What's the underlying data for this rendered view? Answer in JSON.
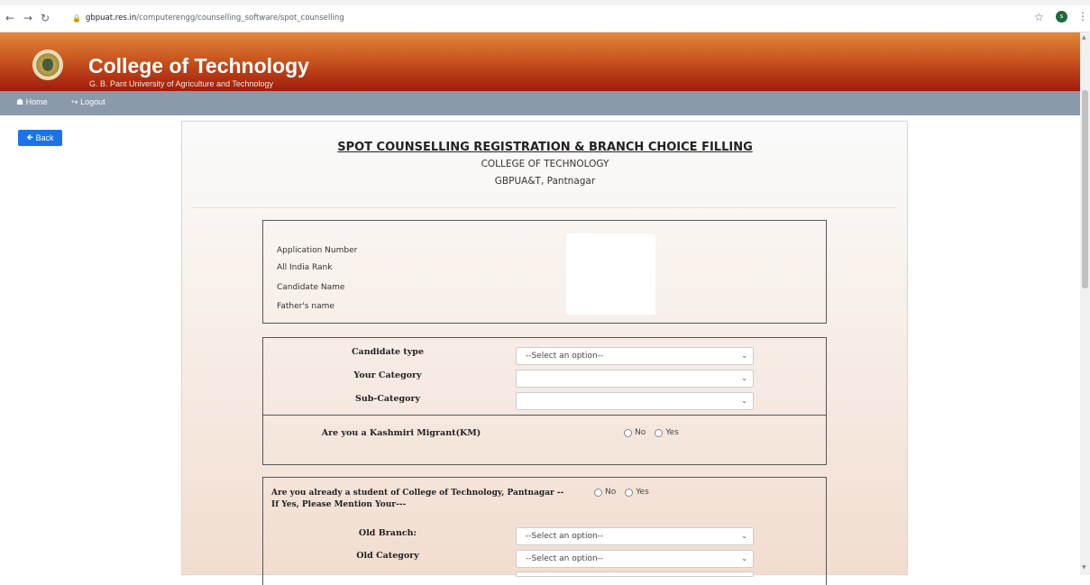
{
  "browser": {
    "url_host": "gbpuat.res.in",
    "url_path": "/computerengg/counselling_software/spot_counselling",
    "profile_initial": "s"
  },
  "header": {
    "title": "College of Technology",
    "subtitle": "G. B. Pant University of Agriculture and Technology"
  },
  "nav": {
    "home": "Home",
    "logout": "Logout"
  },
  "back_label": "Back",
  "form": {
    "title": "SPOT COUNSELLING REGISTRATION & BRANCH CHOICE FILLING",
    "subtitle1": "COLLEGE OF TECHNOLOGY",
    "subtitle2": "GBPUA&T, Pantnagar",
    "info_labels": {
      "application_number": "Application Number",
      "all_india_rank": "All India Rank",
      "candidate_name": "Candidate Name",
      "fathers_name": "Father's name"
    },
    "candidate_type": {
      "label": "Candidate type",
      "value": "--Select an option--"
    },
    "category": {
      "label": "Your Category",
      "value": ""
    },
    "sub_category": {
      "label": "Sub-Category",
      "value": ""
    },
    "kashmiri": {
      "label": "Are you a Kashmiri Migrant(KM)",
      "no": "No",
      "yes": "Yes"
    },
    "existing_student": {
      "question": "Are you already a student of College of Technology, Pantnagar --",
      "note": "If Yes, Please Mention Your---",
      "no": "No",
      "yes": "Yes"
    },
    "old_branch": {
      "label": "Old Branch:",
      "value": "--Select an option--"
    },
    "old_category": {
      "label": "Old Category",
      "value": "--Select an option--"
    }
  }
}
